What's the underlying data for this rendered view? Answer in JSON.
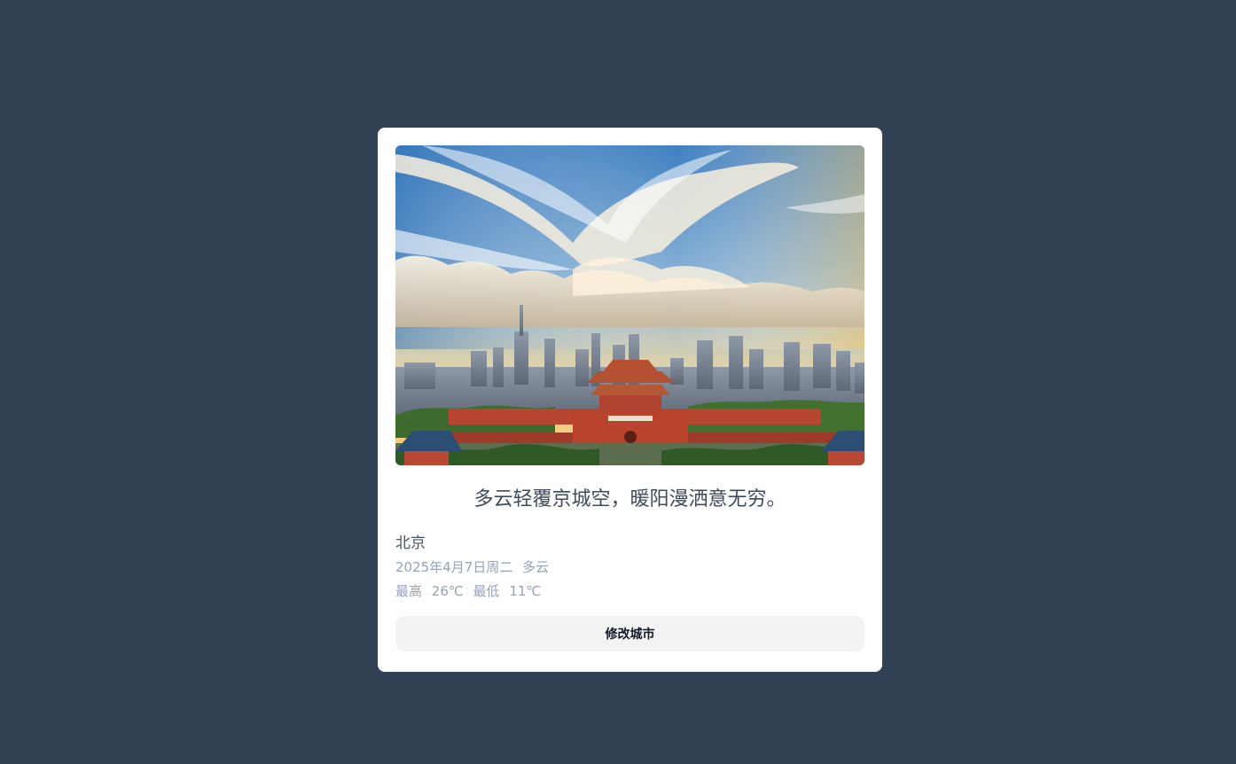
{
  "card": {
    "quote": "多云轻覆京城空，暖阳漫洒意无穷。",
    "city": "北京",
    "date": "2025年4月7日周二",
    "condition": "多云",
    "high_label": "最高",
    "high_value": "26℃",
    "low_label": "最低",
    "low_value": "11℃",
    "button_label": "修改城市"
  },
  "colors": {
    "background": "#334155",
    "card": "#ffffff",
    "button": "#f3f3f3"
  },
  "icons": {
    "hero_image": "beijing-forbidden-city-skyline-photo"
  }
}
